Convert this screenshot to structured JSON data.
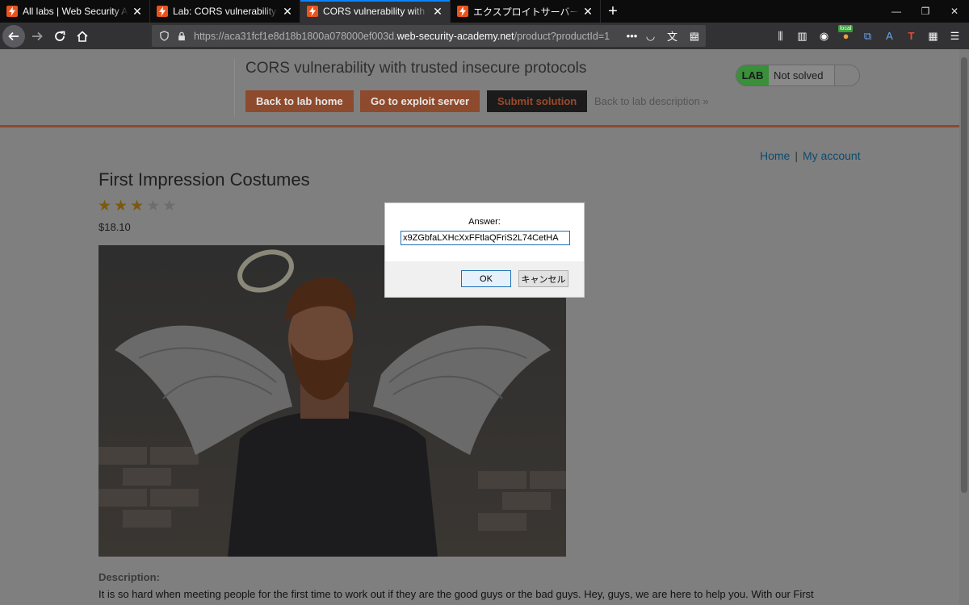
{
  "tabs": [
    {
      "title": "All labs | Web Security Academy",
      "active": false
    },
    {
      "title": "Lab: CORS vulnerability with trusted insecure protocols",
      "active": false
    },
    {
      "title": "CORS vulnerability with trusted insecure protocols",
      "active": true
    },
    {
      "title": "エクスプロイトサーバー：信頼できるプロトコル",
      "active": false
    }
  ],
  "url": {
    "prefix": "https://aca31fcf1e8d18b1800a078000ef003d.",
    "domain": "web-security-academy.net",
    "path": "/product?productId=1"
  },
  "toolbar": {
    "local_badge": "local"
  },
  "header": {
    "lab_title": "CORS vulnerability with trusted insecure protocols",
    "btn_lab_home": "Back to lab home",
    "btn_exploit": "Go to exploit server",
    "btn_submit": "Submit solution",
    "back_desc": "Back to lab description »",
    "status_lab": "LAB",
    "status_text": "Not solved"
  },
  "nav": {
    "home": "Home",
    "sep": "|",
    "account": "My account"
  },
  "product": {
    "title": "First Impression Costumes",
    "rating": 3,
    "rating_max": 5,
    "price": "$18.10",
    "description_label": "Description:",
    "description": "It is so hard when meeting people for the first time to work out if they are the good guys or the bad guys. Hey, guys, we are here to help you. With our First Impression Costumes, you can show the world exactly which team you're on."
  },
  "dialog": {
    "message": "Answer:",
    "answer": "x9ZGbfaLXHcXxFFtlaQFriS2L74CetHA",
    "ok": "OK",
    "cancel": "キャンセル"
  }
}
